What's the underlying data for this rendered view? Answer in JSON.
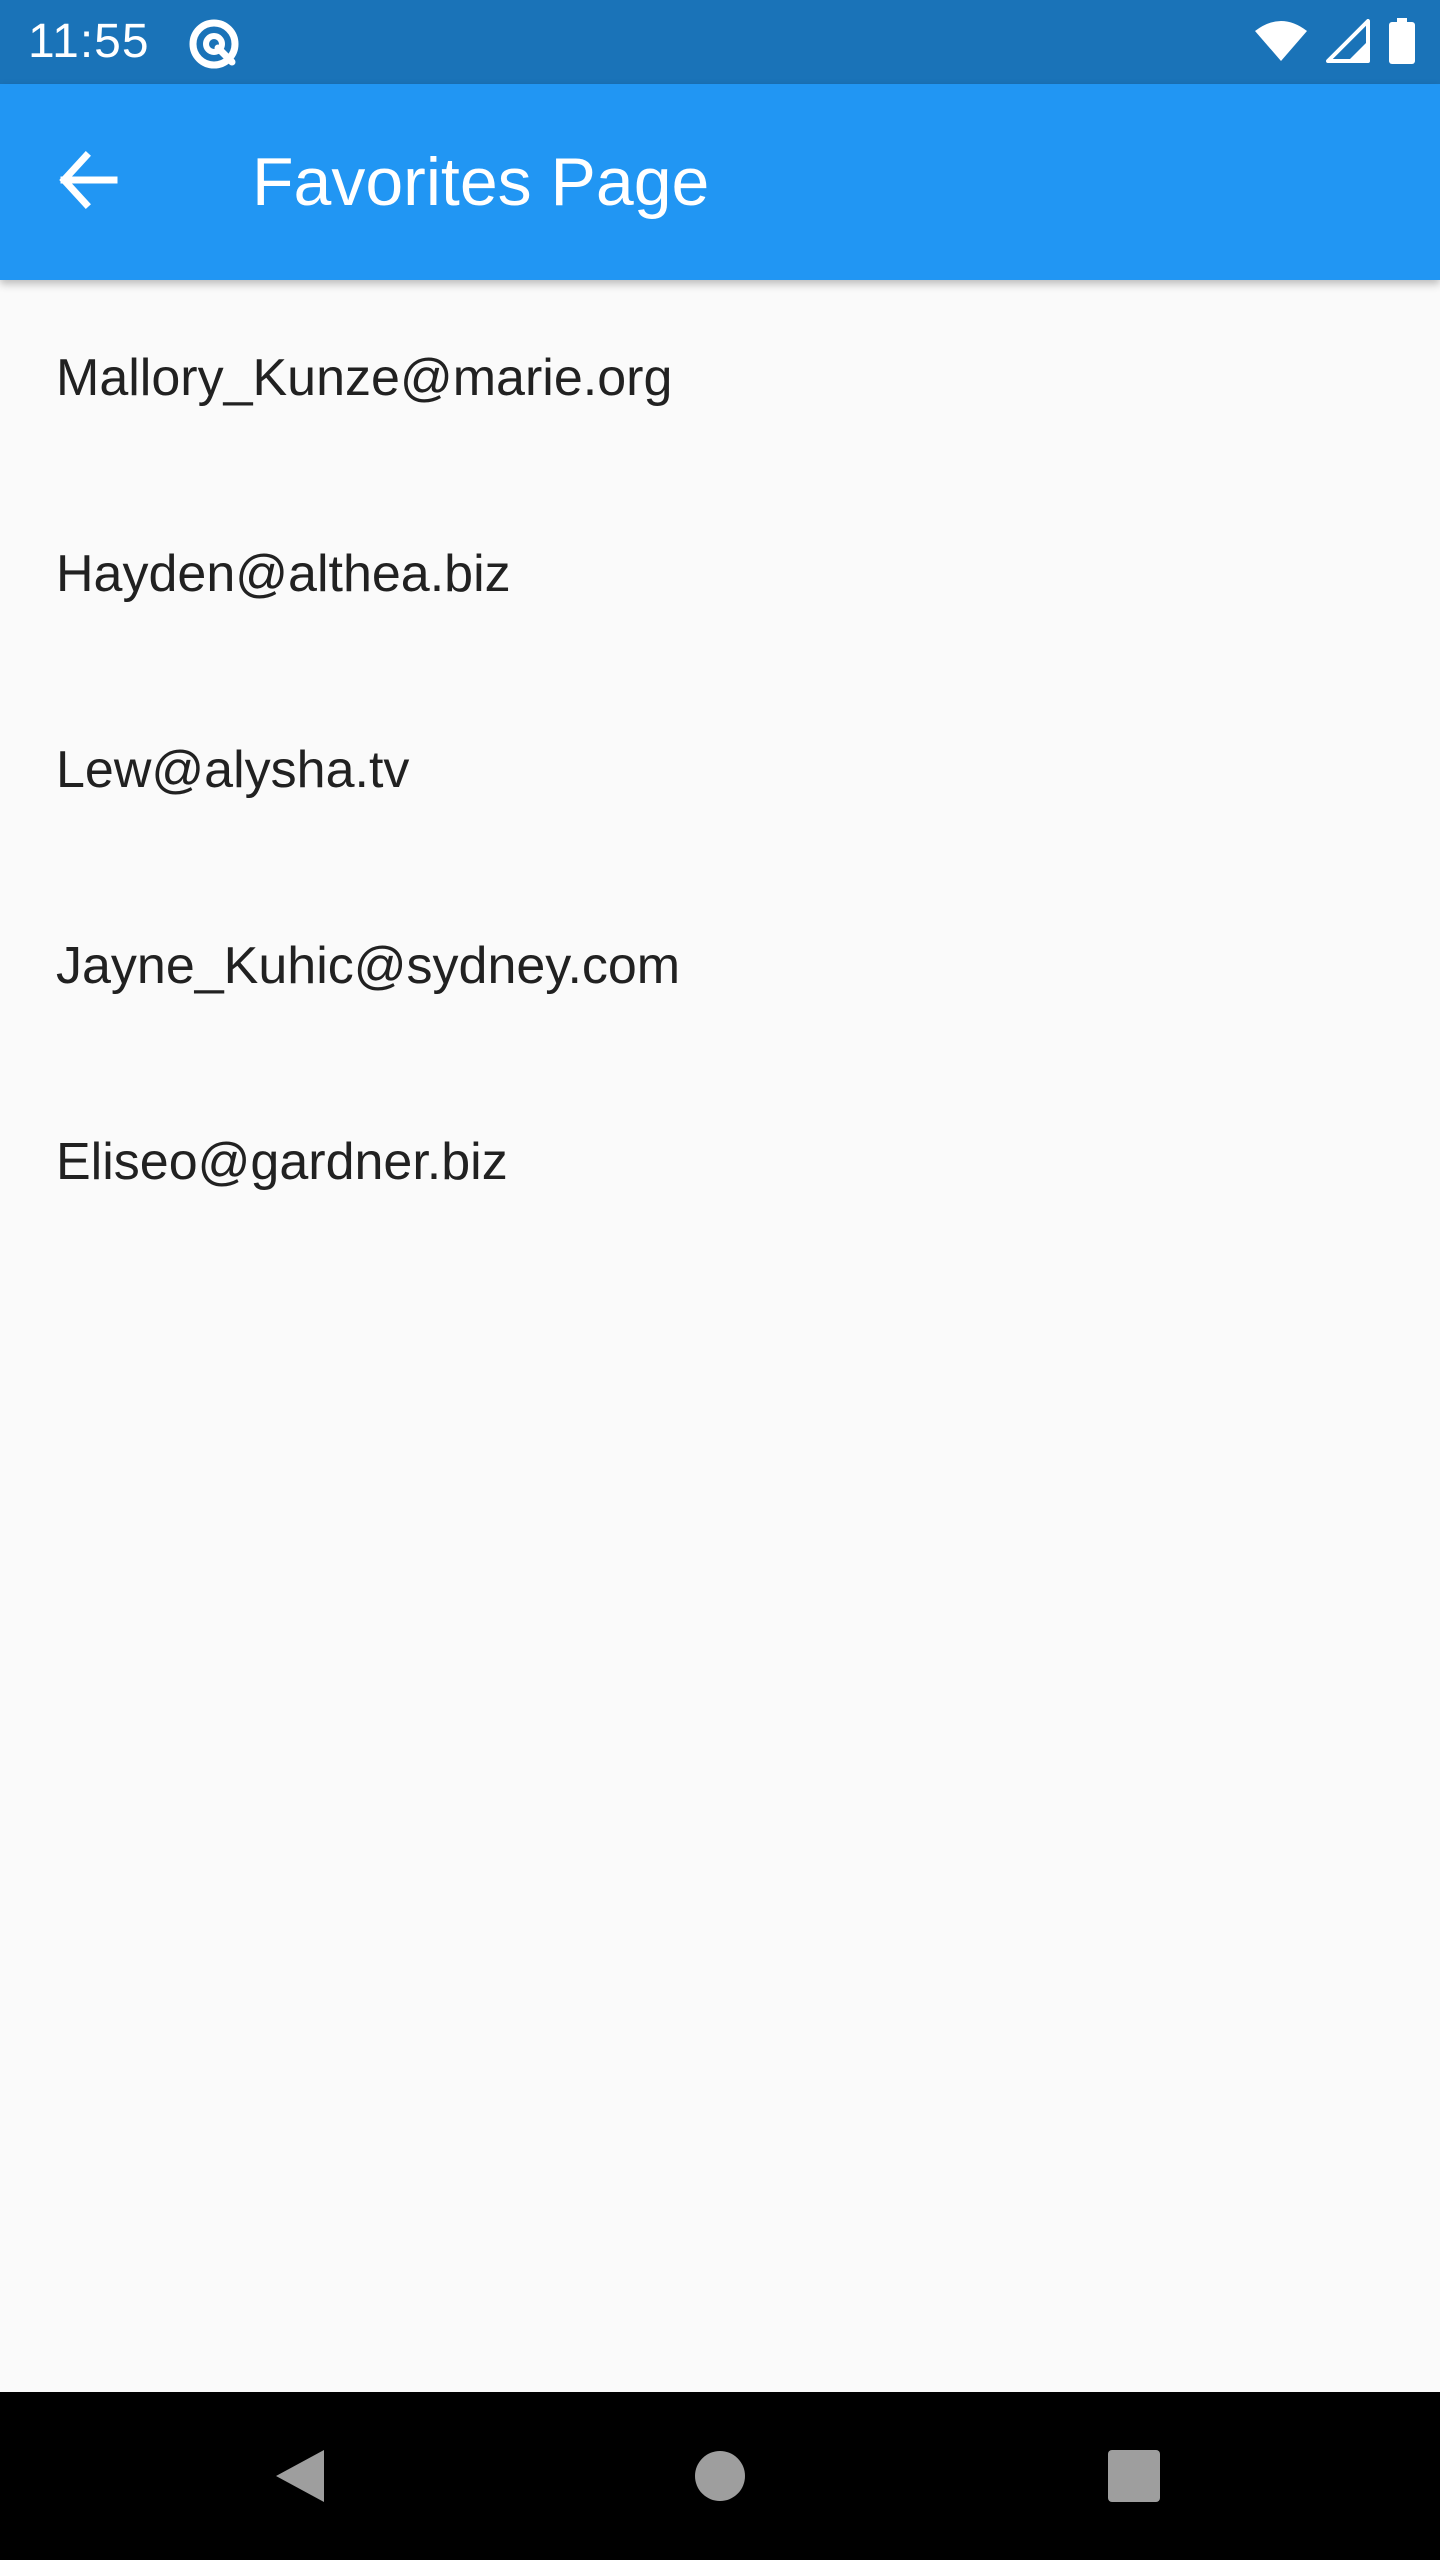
{
  "status_bar": {
    "time": "11:55",
    "icons": [
      "app-notification-icon",
      "wifi-icon",
      "signal-icon",
      "battery-icon"
    ],
    "background_color": "#1a73b8"
  },
  "app_bar": {
    "title": "Favorites Page",
    "back_icon": "arrow-back-icon",
    "background_color": "#2196f3"
  },
  "favorites": [
    {
      "email": "Mallory_Kunze@marie.org"
    },
    {
      "email": "Hayden@althea.biz"
    },
    {
      "email": "Lew@alysha.tv"
    },
    {
      "email": "Jayne_Kuhic@sydney.com"
    },
    {
      "email": "Eliseo@gardner.biz"
    }
  ],
  "nav_bar": {
    "buttons": [
      "nav-back-icon",
      "nav-home-icon",
      "nav-recents-icon"
    ]
  }
}
